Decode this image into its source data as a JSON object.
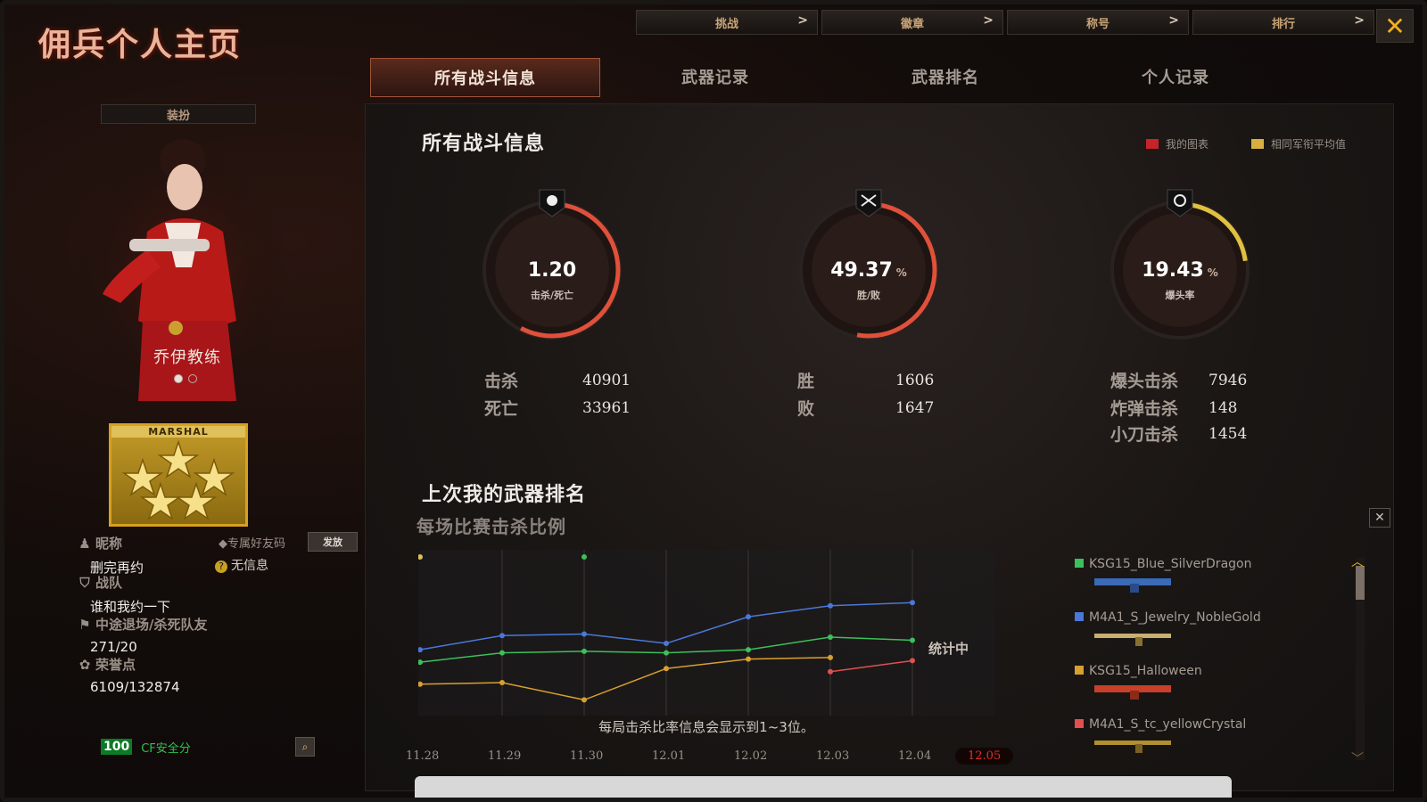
{
  "window": {
    "title": "佣兵个人主页",
    "close_icon": "✕"
  },
  "top_nav": [
    {
      "label": "挑战",
      "chevron": ">"
    },
    {
      "label": "徽章",
      "chevron": ">"
    },
    {
      "label": "称号",
      "chevron": ">"
    },
    {
      "label": "排行",
      "chevron": ">"
    }
  ],
  "tabs": [
    {
      "label": "所有战斗信息",
      "active": true
    },
    {
      "label": "武器记录",
      "active": false
    },
    {
      "label": "武器排名",
      "active": false
    },
    {
      "label": "个人记录",
      "active": false
    }
  ],
  "left": {
    "outfit_label": "装扮",
    "character_name": "乔伊教练",
    "rank_label": "MARSHAL",
    "nickname_label": "昵称",
    "nickname_value": "删完再约",
    "friend_code_label": "专属好友码",
    "send_button": "发放",
    "friend_code_value": "无信息",
    "team_label": "战队",
    "team_value": "谁和我约一下",
    "quit_label": "中途退场/杀死队友",
    "quit_value": "271/20",
    "honor_label": "荣誉点",
    "honor_value": "6109/132874",
    "security_score": "100",
    "security_label": "CF安全分"
  },
  "stats": {
    "title": "所有战斗信息",
    "legend": {
      "mine": "我的图表",
      "avg": "相同军衔平均值",
      "mine_color": "#c8232a",
      "avg_color": "#d8b040"
    },
    "rings": [
      {
        "value": "1.20",
        "unit": "",
        "label": "击杀/死亡"
      },
      {
        "value": "49.37",
        "unit": "%",
        "label": "胜/败"
      },
      {
        "value": "19.43",
        "unit": "%",
        "label": "爆头率"
      }
    ],
    "kd": {
      "kill_label": "击杀",
      "kill_value": "40901",
      "death_label": "死亡",
      "death_value": "33961"
    },
    "wl": {
      "win_label": "胜",
      "win_value": "1606",
      "lose_label": "败",
      "lose_value": "1647"
    },
    "special": {
      "headshot_label": "爆头击杀",
      "headshot_value": "7946",
      "bomb_label": "炸弹击杀",
      "bomb_value": "148",
      "knife_label": "小刀击杀",
      "knife_value": "1454"
    }
  },
  "weapon_rank": {
    "title": "上次我的武器排名",
    "subtitle": "每场比赛击杀比例",
    "counting_label": "统计中",
    "note": "每局击杀比率信息会显示到1~3位。",
    "close_icon": "✕",
    "weapons": [
      {
        "name": "KSG15_Blue_SilverDragon",
        "color": "#3cc05a"
      },
      {
        "name": "M4A1_S_Jewelry_NobleGold",
        "color": "#4a78d8"
      },
      {
        "name": "KSG15_Halloween",
        "color": "#d8a030"
      },
      {
        "name": "M4A1_S_tc_yellowCrystal",
        "color": "#e05050"
      }
    ]
  },
  "chart_data": {
    "type": "line",
    "x": [
      "11.28",
      "11.29",
      "11.30",
      "12.01",
      "12.02",
      "12.03",
      "12.04",
      "12.05"
    ],
    "selected_x": "12.05",
    "series": [
      {
        "name": "KSG15_Blue_SilverDragon",
        "color": "#3cc05a",
        "values": [
          3.4,
          4.0,
          4.1,
          4.0,
          4.2,
          5.0,
          4.8,
          null
        ]
      },
      {
        "name": "M4A1_S_Jewelry_NobleGold",
        "color": "#4a78d8",
        "values": [
          4.2,
          5.1,
          5.2,
          4.6,
          6.3,
          7.0,
          7.2,
          null
        ]
      },
      {
        "name": "KSG15_Halloween",
        "color": "#d8a030",
        "values": [
          2.0,
          2.1,
          1.0,
          3.0,
          3.6,
          3.7,
          null,
          null
        ]
      },
      {
        "name": "M4A1_S_tc_yellowCrystal",
        "color": "#e05050",
        "values": [
          null,
          null,
          null,
          null,
          null,
          2.8,
          3.5,
          null
        ]
      }
    ],
    "top_markers": [
      {
        "x": "11.28",
        "color": "#d8c060"
      },
      {
        "x": "11.30",
        "color": "#3cc05a"
      }
    ],
    "ylim": [
      0,
      10
    ],
    "grid": true,
    "ring_fractions": [
      0.55,
      0.5,
      0.2
    ]
  }
}
